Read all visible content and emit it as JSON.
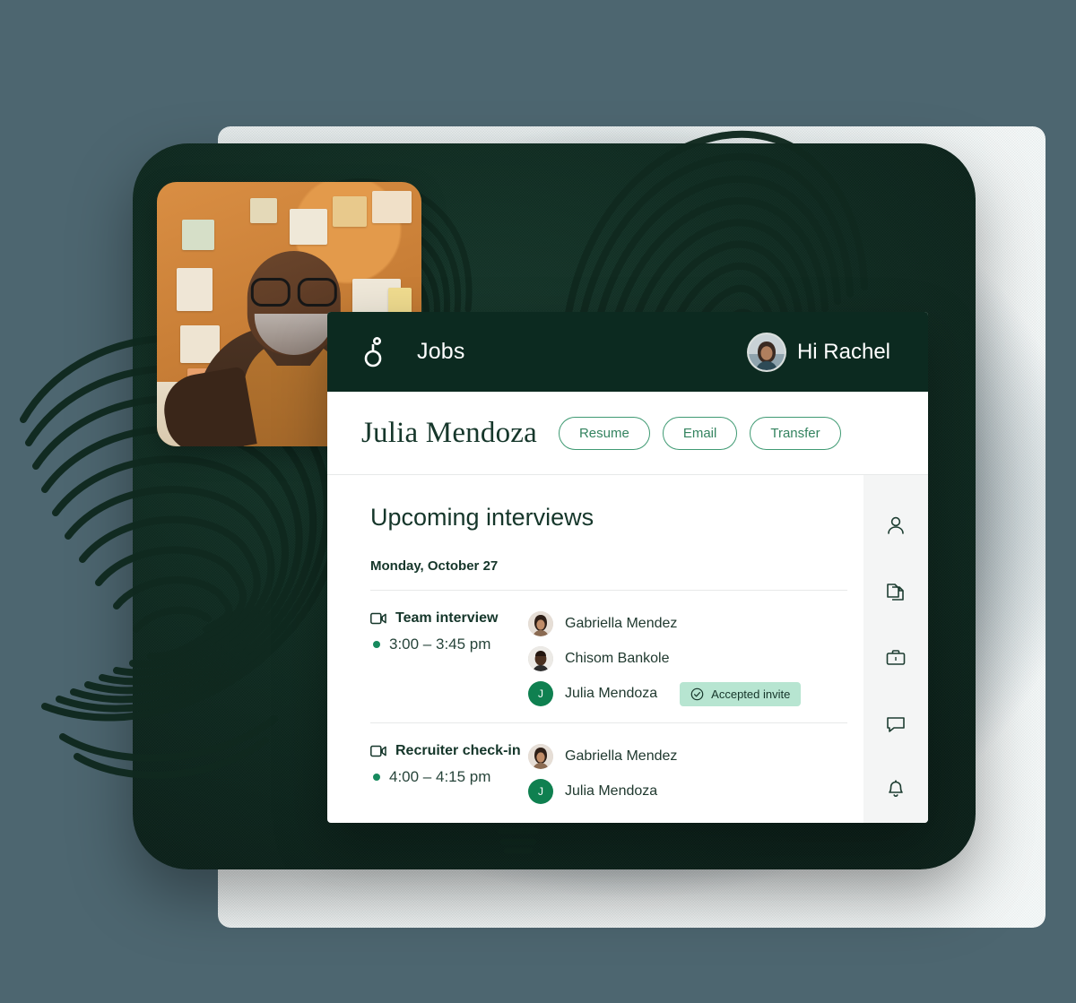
{
  "palette": {
    "page_background": "#4d6670",
    "card_dark_green": "#0f2a20",
    "topbar_green": "#0c2a20",
    "accent_green": "#33835f",
    "pill_border": "#3f9a73",
    "status_dot": "#178a5e",
    "badge_background": "#b7e5d1",
    "avatar_initial_background": "#0f8050",
    "rail_background": "#f4f5f5",
    "photo_board_orange": "#c97f37"
  },
  "topbar": {
    "logo_icon": "greenhouse-g-logo-icon",
    "title": "Jobs",
    "avatar_icon": "user-avatar",
    "greeting": "Hi Rachel"
  },
  "namebar": {
    "candidate_name": "Julia Mendoza",
    "actions": [
      {
        "label": "Resume",
        "name": "resume-button"
      },
      {
        "label": "Email",
        "name": "email-button"
      },
      {
        "label": "Transfer",
        "name": "transfer-button"
      }
    ]
  },
  "main": {
    "heading": "Upcoming interviews",
    "date": "Monday, October 27",
    "events": [
      {
        "icon": "video-camera-icon",
        "title": "Team interview",
        "time": "3:00 – 3:45 pm",
        "attendees": [
          {
            "name": "Gabriella Mendez",
            "avatar_type": "photo",
            "initial": ""
          },
          {
            "name": "Chisom Bankole",
            "avatar_type": "photo",
            "initial": ""
          },
          {
            "name": "Julia Mendoza",
            "avatar_type": "initial",
            "initial": "J",
            "badge": {
              "icon": "check-circle-icon",
              "label": "Accepted invite"
            }
          }
        ]
      },
      {
        "icon": "video-camera-icon",
        "title": "Recruiter check-in",
        "time": "4:00 – 4:15 pm",
        "attendees": [
          {
            "name": "Gabriella Mendez",
            "avatar_type": "photo",
            "initial": ""
          },
          {
            "name": "Julia Mendoza",
            "avatar_type": "initial",
            "initial": "J"
          }
        ]
      }
    ]
  },
  "rail": {
    "items": [
      {
        "icon": "person-icon",
        "name": "rail-item-profile"
      },
      {
        "icon": "documents-icon",
        "name": "rail-item-documents"
      },
      {
        "icon": "briefcase-icon",
        "name": "rail-item-jobs"
      },
      {
        "icon": "chat-bubble-icon",
        "name": "rail-item-messages"
      },
      {
        "icon": "bell-icon",
        "name": "rail-item-notifications"
      }
    ]
  },
  "decor": {
    "photo_alt": "smiling-man-at-desk-with-corkboard",
    "texture": "fingerprint-scribble-texture"
  }
}
